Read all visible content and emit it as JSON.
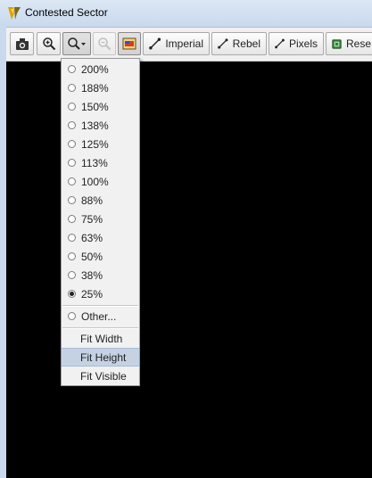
{
  "window": {
    "title": "Contested Sector"
  },
  "toolbar": {
    "buttons": [
      {
        "icon": "camera-icon"
      },
      {
        "icon": "zoom-in-icon"
      },
      {
        "icon": "zoom-dropdown-icon"
      },
      {
        "icon": "zoom-out-icon",
        "disabled": true
      },
      {
        "icon": "map-view-icon",
        "pressed": true
      },
      {
        "icon": "line-tool-icon",
        "label": "Imperial"
      },
      {
        "icon": "line-tool-icon",
        "label": "Rebel"
      },
      {
        "icon": "line-tool-icon",
        "label": "Pixels"
      },
      {
        "icon": "reset-icon",
        "label": "Rese"
      }
    ]
  },
  "zoom_menu": {
    "options": [
      "200%",
      "188%",
      "150%",
      "138%",
      "125%",
      "113%",
      "100%",
      "88%",
      "75%",
      "63%",
      "50%",
      "38%",
      "25%"
    ],
    "selected": "25%",
    "other": "Other...",
    "fit_options": [
      "Fit Width",
      "Fit Height",
      "Fit Visible"
    ],
    "highlighted": "Fit Height"
  },
  "colors": {
    "canvas": "#000000",
    "menu_highlight": "#c4d2e4",
    "chrome": "#c9d9ee"
  }
}
